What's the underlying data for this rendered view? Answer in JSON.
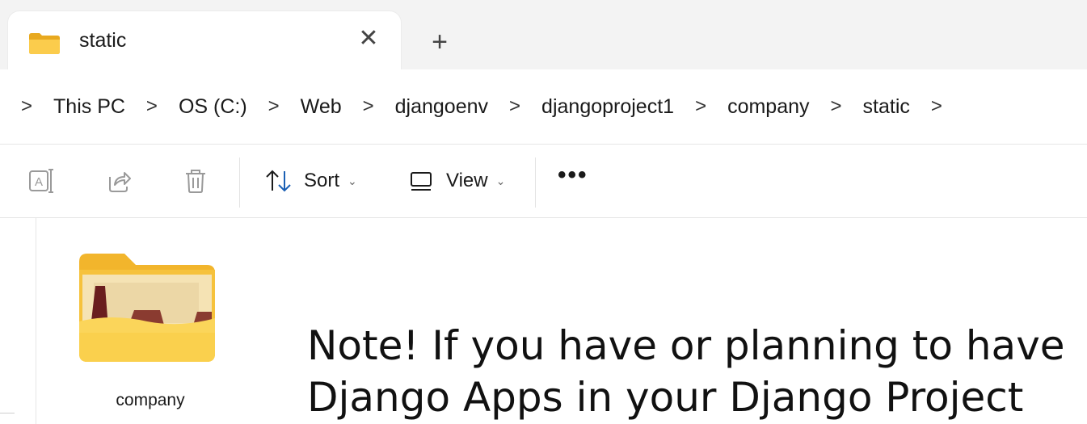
{
  "tab": {
    "title": "static",
    "close_glyph": "✕",
    "icon": "folder-icon"
  },
  "new_tab_glyph": "+",
  "breadcrumb": {
    "separator": ">",
    "items": [
      "This PC",
      "OS (C:)",
      "Web",
      "djangoenv",
      "djangoproject1",
      "company",
      "static"
    ]
  },
  "toolbar": {
    "rename_icon": "rename-icon",
    "share_icon": "share-icon",
    "delete_icon": "delete-icon",
    "sort_label": "Sort",
    "view_label": "View",
    "more_label": "•••"
  },
  "content": {
    "folder": {
      "name": "company",
      "icon": "open-folder-icon"
    }
  },
  "note": {
    "line1": "Note! If you have or planning to have",
    "line2": "Django Apps in your Django Project"
  },
  "colors": {
    "folder_yellow": "#f9c945",
    "folder_dark": "#6a1e1e",
    "accent": "#1a1a1a"
  }
}
